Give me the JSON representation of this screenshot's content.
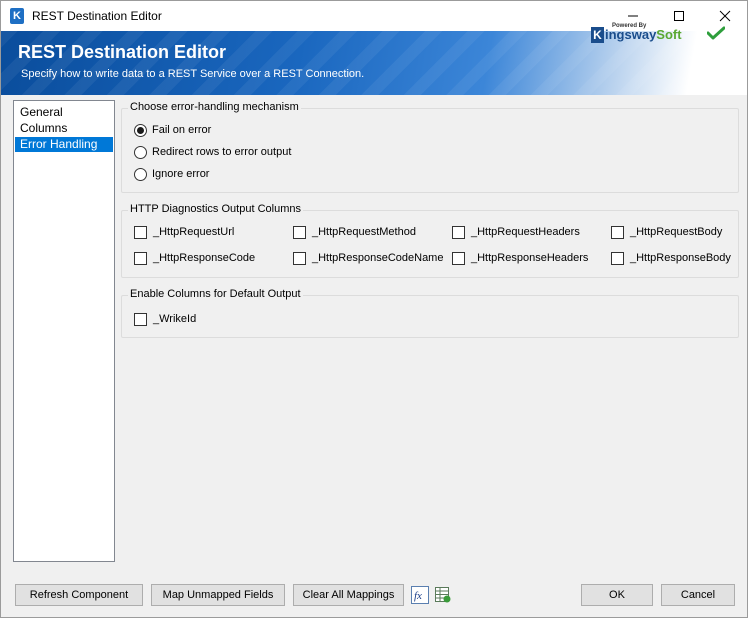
{
  "window": {
    "title": "REST Destination Editor",
    "app_icon_letter": "K"
  },
  "banner": {
    "title": "REST Destination Editor",
    "subtitle": "Specify how to write data to a REST Service over a REST Connection.",
    "brand_powered": "Powered By",
    "brand_k": "K",
    "brand_name_1": "ingsway",
    "brand_name_2": "Soft",
    "accent_color": "#1a67bf"
  },
  "nav": {
    "items": [
      {
        "label": "General"
      },
      {
        "label": "Columns"
      },
      {
        "label": "Error Handling",
        "selected": true
      }
    ]
  },
  "error_handling": {
    "title": "Choose error-handling mechanism",
    "options": [
      {
        "label": "Fail on error",
        "checked": true
      },
      {
        "label": "Redirect rows to error output",
        "checked": false
      },
      {
        "label": "Ignore error",
        "checked": false
      }
    ]
  },
  "http_diagnostics": {
    "title": "HTTP Diagnostics Output Columns",
    "columns": [
      {
        "label": "_HttpRequestUrl",
        "checked": false
      },
      {
        "label": "_HttpRequestMethod",
        "checked": false
      },
      {
        "label": "_HttpRequestHeaders",
        "checked": false
      },
      {
        "label": "_HttpRequestBody",
        "checked": false
      },
      {
        "label": "_HttpResponseCode",
        "checked": false
      },
      {
        "label": "_HttpResponseCodeName",
        "checked": false
      },
      {
        "label": "_HttpResponseHeaders",
        "checked": false
      },
      {
        "label": "_HttpResponseBody",
        "checked": false
      }
    ]
  },
  "default_output": {
    "title": "Enable Columns for Default Output",
    "columns": [
      {
        "label": "_WrikeId",
        "checked": false
      }
    ]
  },
  "buttons": {
    "refresh": "Refresh Component",
    "map_unmapped": "Map Unmapped Fields",
    "clear_mappings": "Clear All Mappings",
    "fx_icon": "fx",
    "ok": "OK",
    "cancel": "Cancel"
  }
}
